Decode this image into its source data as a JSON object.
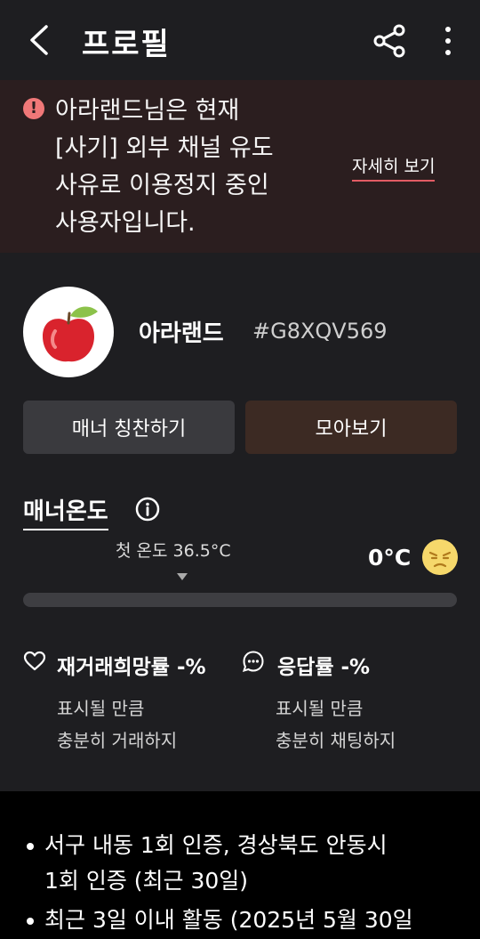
{
  "header": {
    "title": "프로필"
  },
  "banner": {
    "message": "아라랜드님은 현재\n[사기] 외부 채널 유도\n사유로 이용정지 중인\n사용자입니다.",
    "detail_link": "자세히 보기",
    "warn_icon_text": "!"
  },
  "profile": {
    "nickname": "아라랜드",
    "user_code": "#G8XQV569",
    "praise_button": "매너 칭찬하기",
    "collect_button": "모아보기"
  },
  "manner": {
    "title": "매너온도",
    "first_temp_label": "첫 온도 36.5°C",
    "current_temp": "0°C",
    "temperature_value": 0
  },
  "stats": {
    "rebuy_rate": "재거래희망률 -%",
    "rebuy_sub": "표시될 만큼\n충분히 거래하지",
    "response_rate": "응답률 -%",
    "response_sub": "표시될 만큼\n충분히 채팅하지"
  },
  "activity": {
    "items": [
      "서구 내동 1회 인증, 경상북도 안동시\n1회 인증 (최근 30일)",
      "최근 3일 이내 활동 (2025년 5월 30일"
    ]
  },
  "colors": {
    "accent_underline": "#e25c64",
    "banner_bg": "#2b1e1f",
    "collect_bg": "#3c2a23",
    "face": "#f6d86b"
  }
}
